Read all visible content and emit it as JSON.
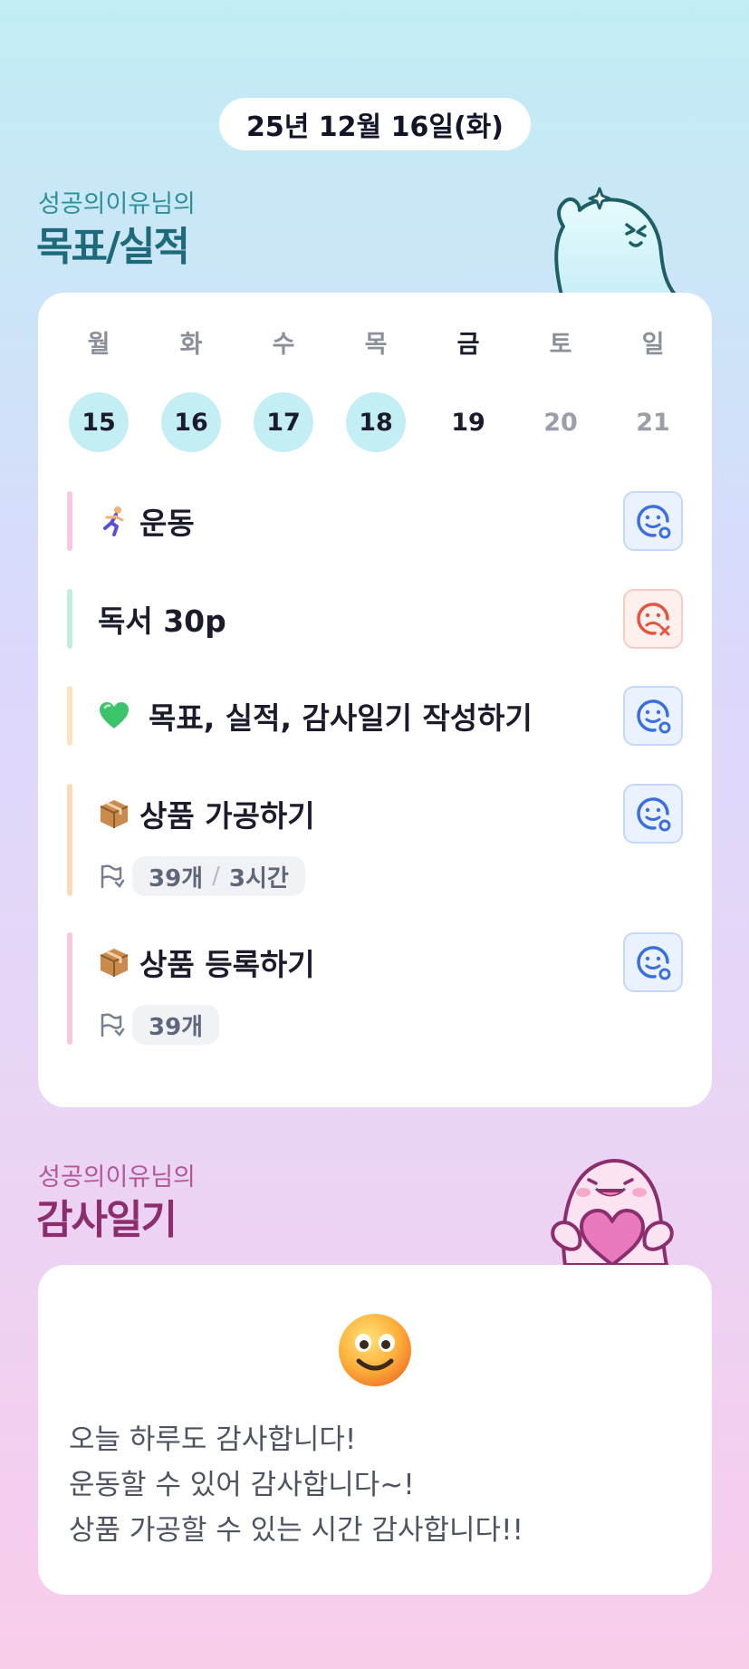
{
  "header": {
    "date": "25년 12월 16일(화)"
  },
  "goals_section": {
    "subtitle": "성공의이유님의",
    "title": "목표/실적"
  },
  "week": [
    {
      "day": "월",
      "date": "15",
      "state": "done"
    },
    {
      "day": "화",
      "date": "16",
      "state": "done"
    },
    {
      "day": "수",
      "date": "17",
      "state": "done"
    },
    {
      "day": "목",
      "date": "18",
      "state": "done"
    },
    {
      "day": "금",
      "date": "19",
      "state": "today"
    },
    {
      "day": "토",
      "date": "20",
      "state": "future"
    },
    {
      "day": "일",
      "date": "21",
      "state": "future"
    }
  ],
  "goals": [
    {
      "icon": "runner-icon",
      "label": "운동",
      "status": "success",
      "bar_color": "#f9c8e6"
    },
    {
      "icon": "",
      "label": "독서 30p",
      "status": "fail",
      "bar_color": "#bfeedd"
    },
    {
      "icon": "green-heart-icon",
      "label": "목표, 실적, 감사일기 작성하기",
      "status": "success",
      "bar_color": "#fde3c0"
    },
    {
      "icon": "package-icon",
      "label": "상품 가공하기",
      "status": "success",
      "bar_color": "#fcd9b8",
      "count": "39개",
      "time": "3시간"
    },
    {
      "icon": "package-icon",
      "label": "상품 등록하기",
      "status": "success",
      "bar_color": "#f9c8dc",
      "count": "39개"
    }
  ],
  "thanks_section": {
    "subtitle": "성공의이유님의",
    "title": "감사일기",
    "emoji": "smiling-face-icon",
    "lines": [
      "오늘 하루도 감사합니다!",
      "운동할 수 있어 감사합니다~!",
      "상품 가공할 수 있는 시간 감사합니다!!"
    ]
  },
  "colors": {
    "success": "#3b6fe0",
    "fail": "#e5543e",
    "done_day": "#c3eef3",
    "goal_title": "#1d6a7a",
    "thanks_title": "#8c2e6e"
  }
}
